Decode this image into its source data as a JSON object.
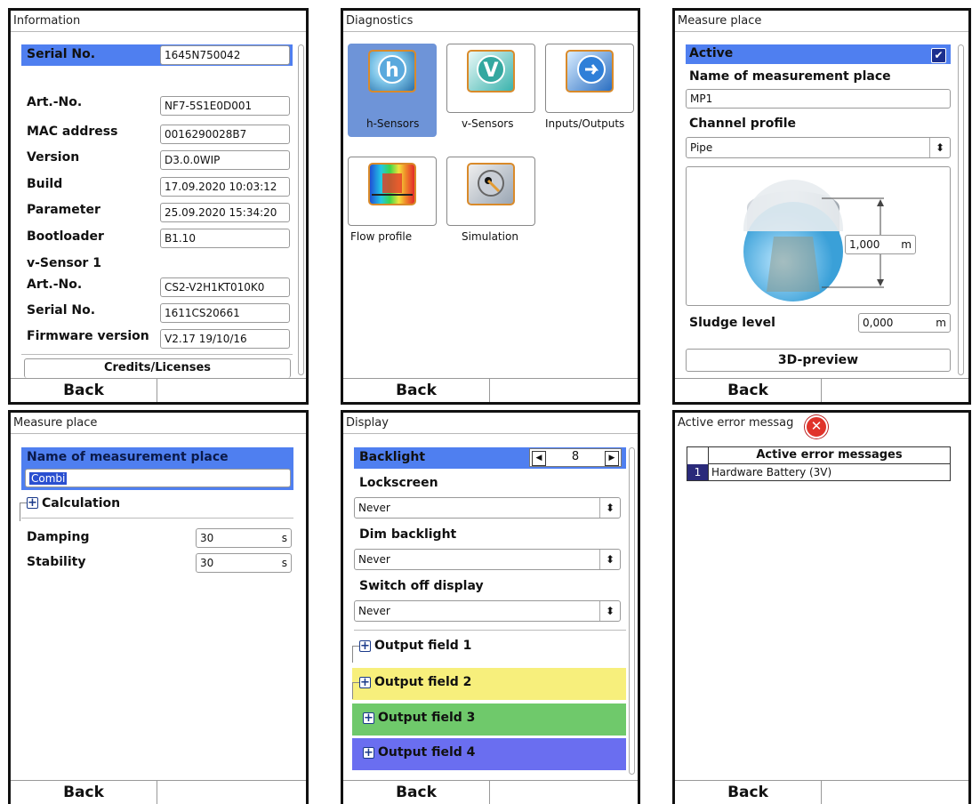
{
  "info": {
    "title": "Information",
    "rows": [
      {
        "label": "Serial No.",
        "value": "1645N750042"
      },
      {
        "label": "Art.-No.",
        "value": "NF7-5S1E0D001"
      },
      {
        "label": "MAC address",
        "value": "0016290028B7"
      },
      {
        "label": "Version",
        "value": "D3.0.0WIP"
      },
      {
        "label": "Build",
        "value": "17.09.2020 10:03:12"
      },
      {
        "label": "Parameter",
        "value": "25.09.2020 15:34:20"
      },
      {
        "label": "Bootloader",
        "value": "B1.10"
      },
      {
        "label": "Art.-No.",
        "value": "CS2-V2H1KT010K0"
      },
      {
        "label": "Serial No.",
        "value": "1611CS20661"
      },
      {
        "label": "Firmware version",
        "value": "V2.17 19/10/16"
      }
    ],
    "vsensor_heading": "v-Sensor 1",
    "credits_button": "Credits/Licenses",
    "back": "Back"
  },
  "diag": {
    "title": "Diagnostics",
    "tiles": [
      {
        "label": "h-Sensors",
        "icon": "h-sensor-icon"
      },
      {
        "label": "v-Sensors",
        "icon": "v-sensor-icon"
      },
      {
        "label": "Inputs/Outputs",
        "icon": "inputs-outputs-icon"
      },
      {
        "label": "Flow profile",
        "icon": "flow-profile-icon"
      },
      {
        "label": "Simulation",
        "icon": "simulation-icon"
      }
    ],
    "back": "Back"
  },
  "mp1": {
    "title": "Measure place",
    "active_label": "Active",
    "active_checked": true,
    "name_label": "Name of measurement place",
    "name_value": "MP1",
    "profile_label": "Channel profile",
    "profile_value": "Pipe",
    "diameter_value": "1,000",
    "diameter_unit": "m",
    "sludge_label": "Sludge level",
    "sludge_value": "0,000",
    "sludge_unit": "m",
    "preview_button": "3D-preview",
    "back": "Back"
  },
  "mp2": {
    "title": "Measure place",
    "name_label": "Name of measurement place",
    "name_value": "Combi",
    "calc_label": "Calculation",
    "damping_label": "Damping",
    "damping_value": "30",
    "damping_unit": "s",
    "stability_label": "Stability",
    "stability_value": "30",
    "stability_unit": "s",
    "back": "Back"
  },
  "display": {
    "title": "Display",
    "backlight_label": "Backlight",
    "backlight_value": "8",
    "lockscreen_label": "Lockscreen",
    "lockscreen_value": "Never",
    "dim_label": "Dim backlight",
    "dim_value": "Never",
    "switchoff_label": "Switch off display",
    "switchoff_value": "Never",
    "output_fields": [
      {
        "label": "Output field 1",
        "color": "#ffffff"
      },
      {
        "label": "Output field 2",
        "color": "#f7ef7c"
      },
      {
        "label": "Output field 3",
        "color": "#6fc96b"
      },
      {
        "label": "Output field 4",
        "color": "#6a6ef0"
      }
    ],
    "back": "Back"
  },
  "errors": {
    "title": "Active error messag",
    "table_header": "Active error messages",
    "items": [
      {
        "num": "1",
        "text": "Hardware Battery (3V)"
      }
    ],
    "back": "Back"
  },
  "colors": {
    "highlight": "#4f7ff0",
    "selected_tile": "#6e94d8",
    "error_num_bg": "#2a2a7a"
  }
}
